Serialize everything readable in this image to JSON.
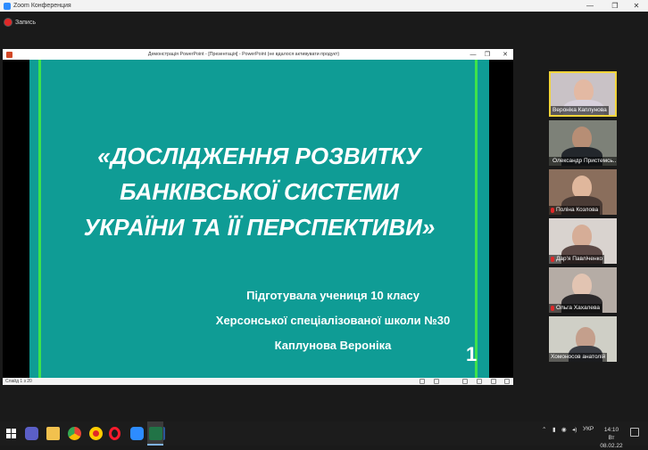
{
  "zoom": {
    "title": "Zoom Конференция",
    "record_label": "Запись",
    "controls": [
      "—",
      "❐",
      "✕"
    ]
  },
  "ppt": {
    "title": "Демонстрація PowerPoint - [Презентація] - PowerPoint (не вдалося активувати продукт)",
    "controls": [
      "—",
      "❐",
      "✕"
    ],
    "status": "Слайд 1 з 20"
  },
  "slide": {
    "title_lines": [
      "«ДОСЛІДЖЕННЯ РОЗВИТКУ",
      "БАНКІВСЬКОЇ СИСТЕМИ",
      "УКРАЇНИ ТА ЇЇ ПЕРСПЕКТИВИ»"
    ],
    "author_lines": [
      "Підготувала учениця 10 класу",
      "Херсонської спеціалізованої школи №30",
      "Каплунова Вероніка"
    ],
    "number": "1",
    "colors": {
      "background": "#0f9c95",
      "stripe": "#3ee34a",
      "text": "#ffffff"
    }
  },
  "participants": [
    {
      "name": "Вероніка Каплунова",
      "muted": false,
      "active": true
    },
    {
      "name": "Олександр Пристемсь...",
      "muted": true,
      "active": false
    },
    {
      "name": "Поліна Козлова",
      "muted": true,
      "active": false
    },
    {
      "name": "Дар'я Павліченко",
      "muted": true,
      "active": false
    },
    {
      "name": "Ольга Хахалева",
      "muted": true,
      "active": false
    },
    {
      "name": "Хомоносов анатолій",
      "muted": false,
      "active": false
    }
  ],
  "taskbar": {
    "icons": [
      "windows-start-icon",
      "teams-icon",
      "file-explorer-icon",
      "chrome-icon",
      "yandex-icon",
      "opera-icon",
      "zoom-icon",
      "word-icon",
      "excel-icon"
    ],
    "tray_language": "УКР",
    "time": "14:10",
    "date": "Вт 08.02.22"
  }
}
